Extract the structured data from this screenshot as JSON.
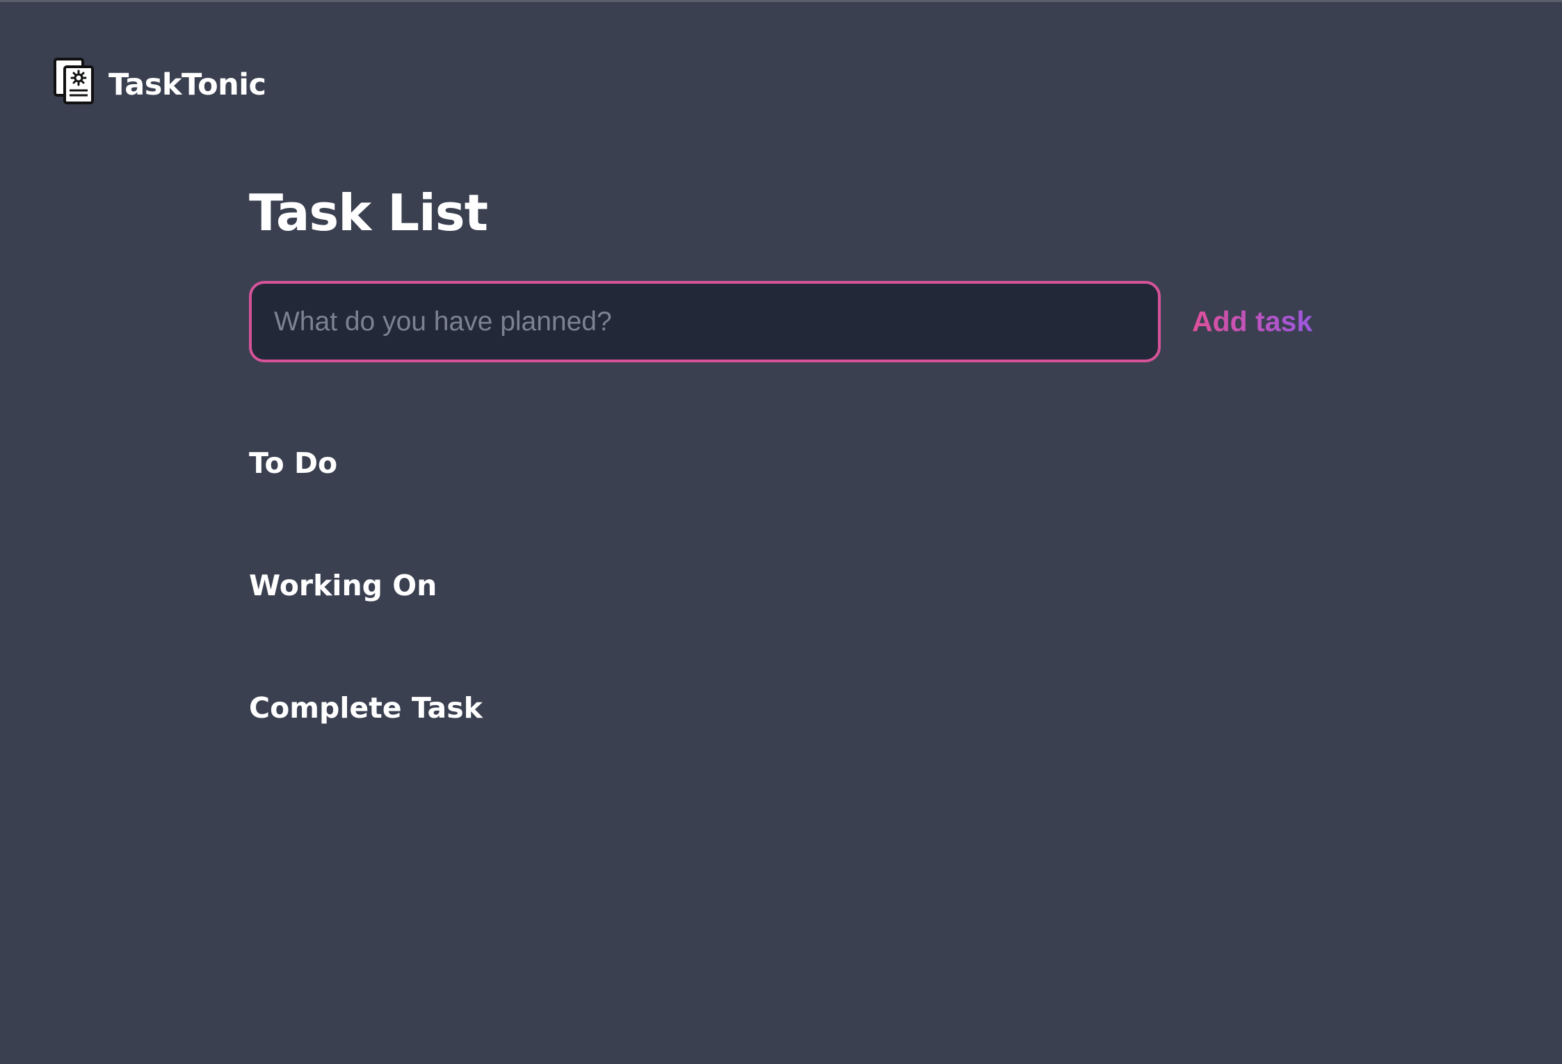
{
  "app": {
    "name": "TaskTonic",
    "logo_icon": "document-gear-icon"
  },
  "main": {
    "title": "Task List",
    "input": {
      "placeholder": "What do you have planned?",
      "value": ""
    },
    "add_button_label": "Add task",
    "sections": {
      "todo": "To Do",
      "working": "Working On",
      "complete": "Complete Task"
    }
  },
  "colors": {
    "background": "#3a4050",
    "input_background": "#222838",
    "accent_pink": "#d6539a",
    "accent_purple": "#9b58e0",
    "text": "#ffffff"
  }
}
